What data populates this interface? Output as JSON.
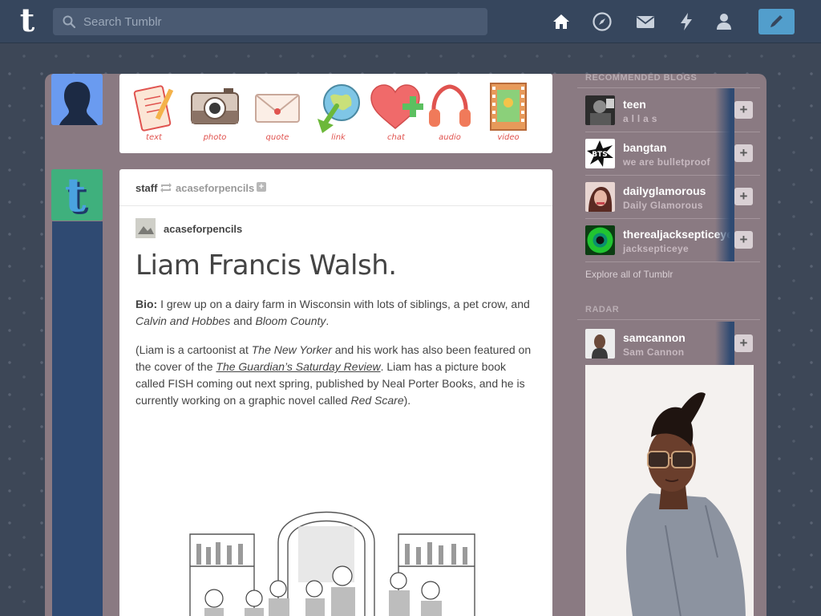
{
  "header": {
    "logo": "t",
    "search_placeholder": "Search Tumblr"
  },
  "post_types": [
    {
      "label": "text"
    },
    {
      "label": "photo"
    },
    {
      "label": "quote"
    },
    {
      "label": "link"
    },
    {
      "label": "chat"
    },
    {
      "label": "audio"
    },
    {
      "label": "video"
    }
  ],
  "post": {
    "author": "staff",
    "reblogged_from": "acaseforpencils",
    "follow_symbol": "+",
    "source_name": "acaseforpencils",
    "title": "Liam Francis Walsh.",
    "bio_label": "Bio:",
    "bio_text_1": " I grew up on a dairy farm in Wisconsin with lots of siblings, a pet crow, and ",
    "bio_italic_1": "Calvin and Hobbes",
    "bio_text_2": " and ",
    "bio_italic_2": "Bloom County",
    "bio_text_3": ".",
    "p2_text_1": "(Liam is a cartoonist at ",
    "p2_italic_1": "The New Yorker",
    "p2_text_2": " and his work has also been featured on the cover of the ",
    "p2_link": "The Guardian’s Saturday Review",
    "p2_text_3": ". Liam has a picture book called FISH coming out next spring, published by Neal Porter Books, and he is currently working on a graphic novel called ",
    "p2_italic_2": "Red Scare",
    "p2_text_4": ")."
  },
  "sidebar": {
    "recommended_heading": "RECOMMENDED BLOGS",
    "blogs": [
      {
        "name": "teen",
        "title": "a l l a s",
        "avatar_color": "#3a3a3a"
      },
      {
        "name": "bangtan",
        "title": "we are bulletproof",
        "avatar_color": "#ffffff"
      },
      {
        "name": "dailyglamorous",
        "title": "Daily Glamorous",
        "avatar_color": "#c9a09a"
      },
      {
        "name": "therealjacksepticeye",
        "title": "jacksepticeye",
        "avatar_color": "#21c431"
      }
    ],
    "follow_symbol": "+",
    "explore": "Explore all of Tumblr",
    "radar_heading": "RADAR",
    "radar_blog": {
      "name": "samcannon",
      "title": "Sam Cannon"
    }
  },
  "colors": {
    "header_bg": "#36465d",
    "accent": "#529ecc",
    "post_type_label": "#e0534f"
  }
}
